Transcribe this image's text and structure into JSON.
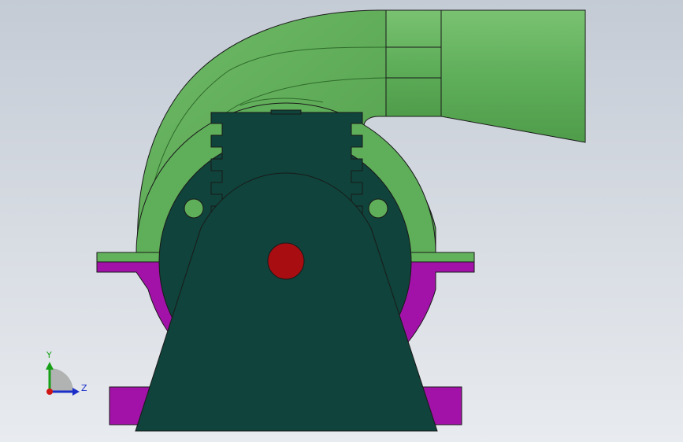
{
  "viewport": {
    "colors": {
      "background_top": "#c9cfd8",
      "background_bottom": "#e6e9ee",
      "housing_green": "#5fae5a",
      "housing_green_light": "#7cc575",
      "housing_green_dark": "#4c9a48",
      "base_magenta": "#a312a8",
      "motor_dark": "#0f433b",
      "shaft_red": "#a80d12",
      "outline": "#1a1a1a"
    }
  },
  "triad": {
    "y_label": "Y",
    "z_label": "Z",
    "colors": {
      "y_axis": "#17a017",
      "z_axis": "#1b2fc8",
      "x_axis": "#d01515",
      "quadrant": "#a8a8a8"
    }
  }
}
